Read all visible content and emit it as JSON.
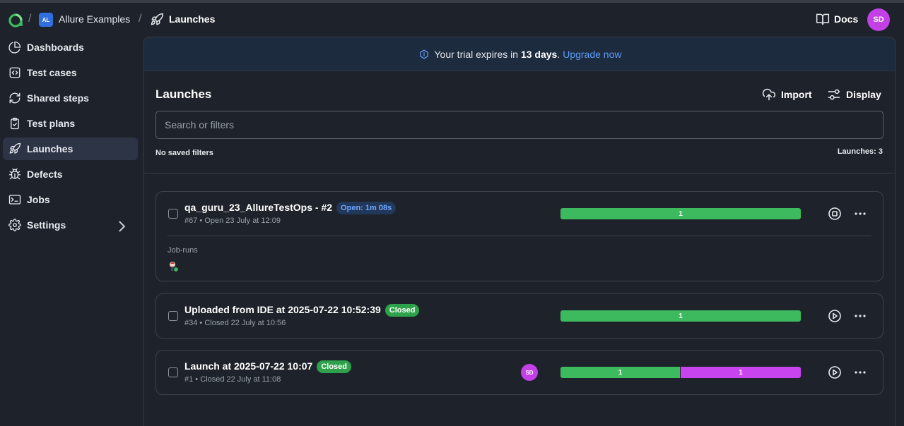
{
  "header": {
    "project_badge": "AL",
    "project_name": "Allure Examples",
    "current": "Launches",
    "docs_label": "Docs",
    "user_initials": "SD"
  },
  "sidebar": {
    "items": [
      {
        "label": "Dashboards",
        "icon": "pie-chart-icon"
      },
      {
        "label": "Test cases",
        "icon": "code-icon"
      },
      {
        "label": "Shared steps",
        "icon": "refresh-icon"
      },
      {
        "label": "Test plans",
        "icon": "clipboard-icon"
      },
      {
        "label": "Launches",
        "icon": "rocket-icon",
        "active": true
      },
      {
        "label": "Defects",
        "icon": "bug-icon"
      },
      {
        "label": "Jobs",
        "icon": "terminal-icon"
      },
      {
        "label": "Settings",
        "icon": "gear-icon"
      }
    ]
  },
  "trial": {
    "prefix": "Your trial expires in",
    "days": "13 days",
    "period": ".",
    "upgrade": "Upgrade now"
  },
  "main": {
    "title": "Launches",
    "import_label": "Import",
    "display_label": "Display",
    "search_placeholder": "Search or filters",
    "saved_filters": "No saved filters",
    "count": "Launches: 3"
  },
  "launches": [
    {
      "name": "qa_guru_23_AllureTestOps - #2",
      "status": "Open: 1m 08s",
      "meta": "#67 • Open 23 July at 12:09",
      "segments": [
        {
          "value": "1",
          "color": "#3dba5e",
          "share": 1
        }
      ],
      "action": "stop-icon",
      "job_runs_label": "Job-runs"
    },
    {
      "name": "Uploaded from IDE at 2025-07-22 10:52:39",
      "status": "Closed",
      "meta": "#34 • Closed 22 July at 10:56",
      "segments": [
        {
          "value": "1",
          "color": "#3dba5e",
          "share": 1
        }
      ],
      "action": "play-icon"
    },
    {
      "name": "Launch at 2025-07-22 10:07",
      "status": "Closed",
      "meta": "#1 • Closed 22 July at 11:08",
      "assignee": "SD",
      "segments": [
        {
          "value": "1",
          "color": "#3dba5e",
          "share": 0.5
        },
        {
          "value": "1",
          "color": "#c844ee",
          "share": 0.5
        }
      ],
      "action": "play-icon"
    }
  ]
}
